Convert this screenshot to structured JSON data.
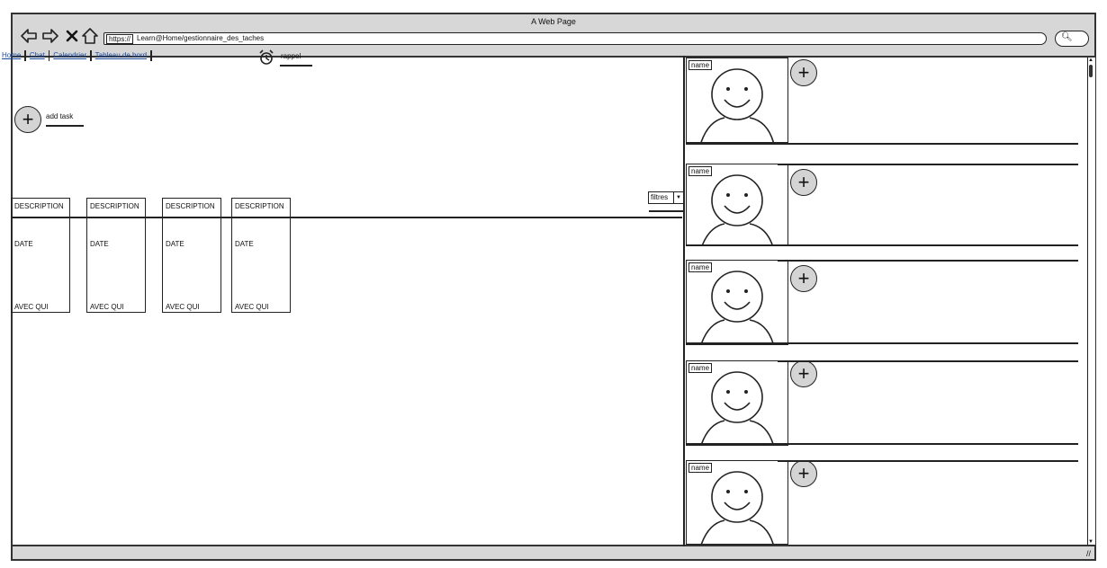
{
  "window": {
    "title": "A Web Page"
  },
  "browser": {
    "url_protocol": "https://",
    "url_path": "Learn@Home/gestionnaire_des_taches"
  },
  "nav": {
    "items": [
      "Home",
      "Chat",
      "Calendrier",
      "Tableau de bord"
    ]
  },
  "reminder": {
    "label": "rappel"
  },
  "add_task": {
    "label": "add task"
  },
  "filter": {
    "label": "filtres"
  },
  "cards": [
    {
      "description": "DESCRIPTION",
      "date": "DATE",
      "avec": "AVEC QUI"
    },
    {
      "description": "DESCRIPTION",
      "date": "DATE",
      "avec": "AVEC QUI"
    },
    {
      "description": "DESCRIPTION",
      "date": "DATE",
      "avec": "AVEC QUI"
    },
    {
      "description": "DESCRIPTION",
      "date": "DATE",
      "avec": "AVEC QUI"
    }
  ],
  "profiles": [
    {
      "name": "name"
    },
    {
      "name": "name"
    },
    {
      "name": "name"
    },
    {
      "name": "name"
    },
    {
      "name": "name"
    }
  ],
  "colors": {
    "chrome": "#d7d7d7",
    "link": "#1a4a9e",
    "plus_fill": "#d4d4d4",
    "stroke": "#222222"
  }
}
